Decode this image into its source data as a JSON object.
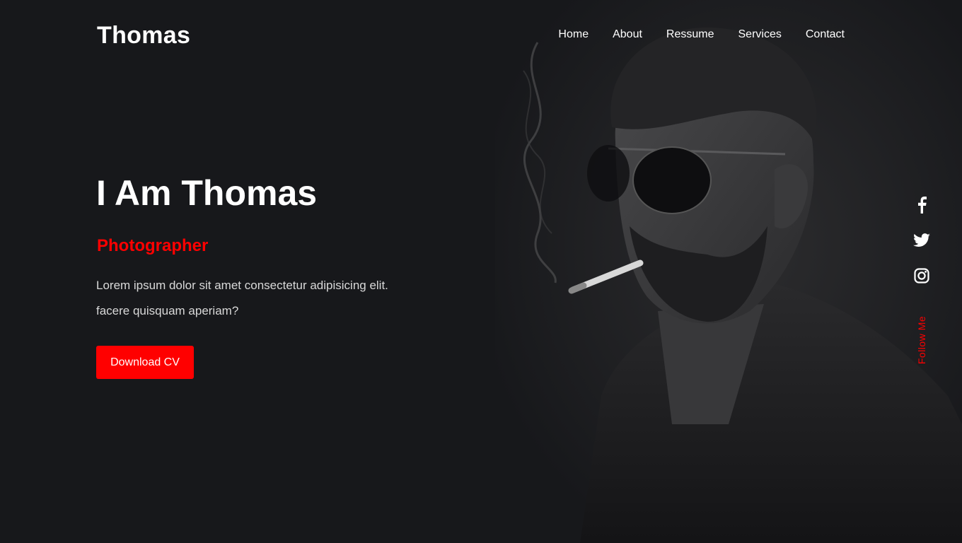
{
  "brand": {
    "name": "Thomas"
  },
  "nav": {
    "items": [
      {
        "label": "Home"
      },
      {
        "label": "About"
      },
      {
        "label": "Ressume"
      },
      {
        "label": "Services"
      },
      {
        "label": "Contact"
      }
    ]
  },
  "hero": {
    "title": "I Am Thomas",
    "subtitle": "Photographer",
    "text_line1": "Lorem ipsum dolor sit amet consectetur adipisicing elit.",
    "text_line2": "facere quisquam aperiam?",
    "cta_label": "Download CV",
    "image": "portrait-photo"
  },
  "social": {
    "icons": [
      "facebook-icon",
      "twitter-icon",
      "instagram-icon"
    ],
    "follow_label": "Follow Me"
  },
  "colors": {
    "background": "#17181b",
    "accent": "#ff0000",
    "text": "#ffffff"
  }
}
